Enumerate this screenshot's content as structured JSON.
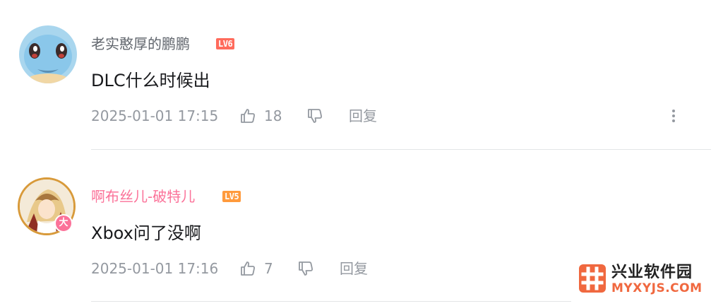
{
  "comments": [
    {
      "username": "老实憨厚的鹏鹏",
      "level": "LV6",
      "content": "DLC什么时候出",
      "time": "2025-01-01 17:15",
      "likes": "18",
      "reply_label": "回复",
      "avatar_icon": "squirtle-avatar-icon",
      "username_color": "#61666d",
      "level_color": "#ff6b5c"
    },
    {
      "username": "啊布丝儿-破特儿",
      "level": "LV5",
      "content": "Xbox问了没啊",
      "time": "2025-01-01 17:16",
      "likes": "7",
      "reply_label": "回复",
      "avatar_icon": "anime-character-avatar-icon",
      "avatar_badge": "大",
      "username_color": "#fb7299",
      "level_color": "#ff9a3c"
    }
  ],
  "watermark": {
    "name": "兴业软件园",
    "url": "MYXYJS.COM"
  }
}
